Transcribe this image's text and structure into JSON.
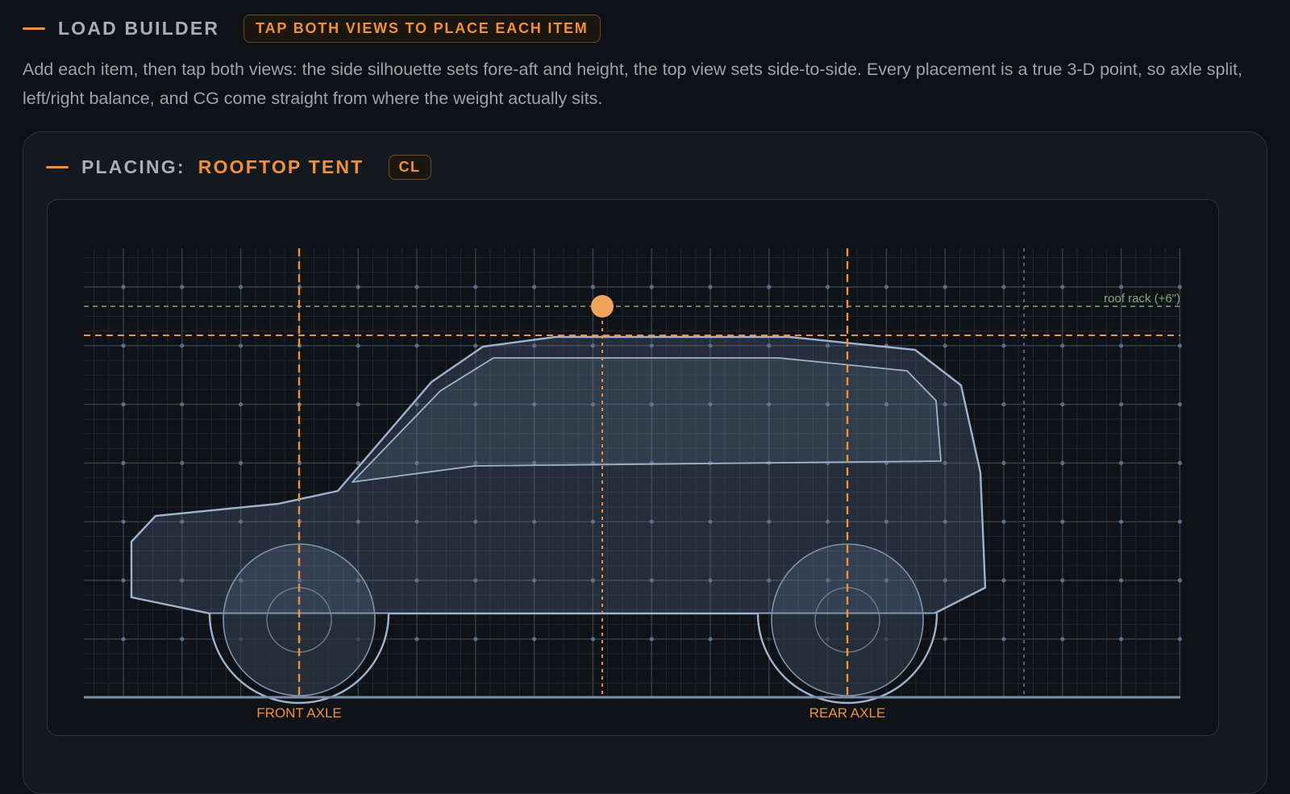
{
  "header": {
    "title": "LOAD BUILDER",
    "hint": "TAP BOTH VIEWS TO PLACE EACH ITEM"
  },
  "description": "Add each item, then tap both views: the side silhouette sets fore-aft and height, the top view sets side-to-side. Every placement is a true 3-D point, so axle split, left/right balance, and CG come straight from where the weight actually sits.",
  "placing": {
    "label": "PLACING:",
    "item": "ROOFTOP TENT",
    "position_badge": "CL"
  },
  "side_view": {
    "roof_rack_label": "roof rack (+6\")",
    "front_axle_label": "FRONT AXLE",
    "rear_axle_label": "REAR AXLE"
  },
  "colors": {
    "accent": "#f0913a",
    "roof_rack_line": "#7fa877",
    "vehicle_outline": "#9fb3cf",
    "background": "#0e1116",
    "panel": "#141920"
  },
  "icons": {
    "placement_marker": "orange-dot"
  }
}
